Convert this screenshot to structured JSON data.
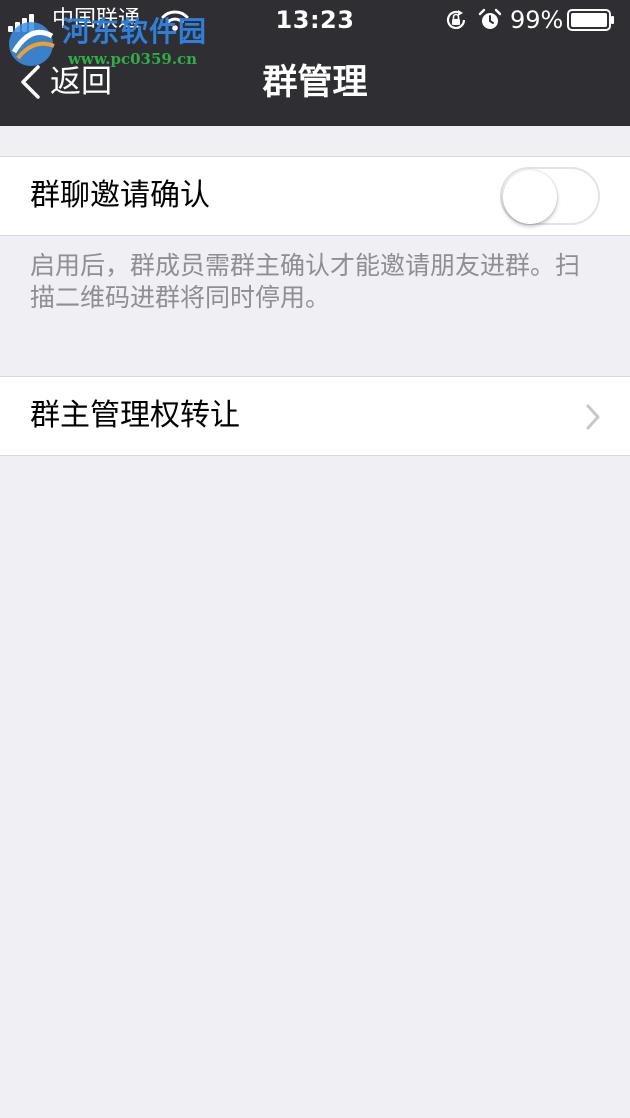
{
  "status_bar": {
    "carrier": "中国联通",
    "time": "13:23",
    "battery_percent": "99%",
    "icons": [
      "signal-icon",
      "wifi-icon",
      "rotation-lock-icon",
      "alarm-icon",
      "battery-icon"
    ]
  },
  "watermark": {
    "name": "河东软件园",
    "url": "www.pc0359.cn"
  },
  "nav": {
    "back_label": "返回",
    "title": "群管理"
  },
  "settings": {
    "invite_confirm": {
      "label": "群聊邀请确认",
      "enabled": false,
      "footer": "启用后，群成员需群主确认才能邀请朋友进群。扫描二维码进群将同时停用。"
    },
    "transfer_ownership": {
      "label": "群主管理权转让"
    }
  },
  "colors": {
    "nav_background": "#2f2f33",
    "page_background": "#efeff4",
    "cell_background": "#ffffff",
    "footer_text": "#8e8e93",
    "separator": "#d8d8dc"
  }
}
